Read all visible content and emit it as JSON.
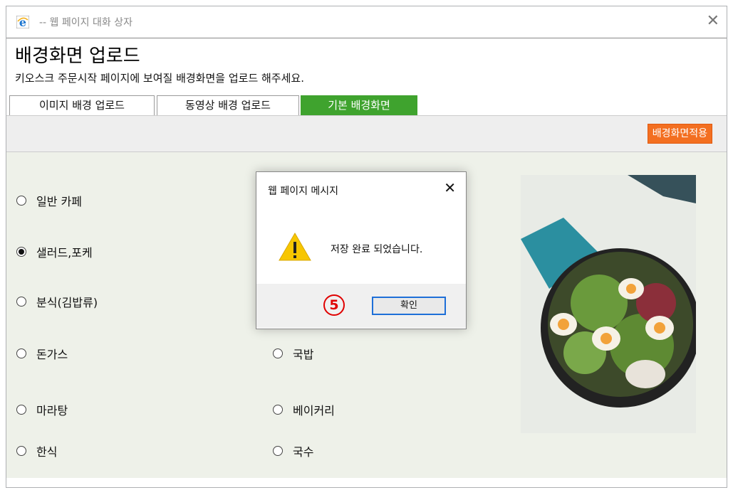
{
  "window": {
    "title": "-- 웹 페이지 대화 상자",
    "close_icon": "close-icon"
  },
  "page": {
    "title": "배경화면 업로드",
    "subtitle": "키오스크 주문시작 페이지에 보여질 배경화면을 업로드 해주세요."
  },
  "tabs": [
    {
      "label": "이미지 배경 업로드",
      "active": false
    },
    {
      "label": "동영상 배경 업로드",
      "active": false
    },
    {
      "label": "기본 배경화면",
      "active": true
    }
  ],
  "toolbar": {
    "apply_label": "배경화면적용"
  },
  "options": [
    {
      "label": "일반 카페",
      "checked": false
    },
    {
      "label": "샐러드,포케",
      "checked": true
    },
    {
      "label": "분식(김밥류)",
      "checked": false
    },
    {
      "label": "돈가스",
      "checked": false
    },
    {
      "label": "마라탕",
      "checked": false
    },
    {
      "label": "한식",
      "checked": false
    },
    {
      "label": "국밥",
      "checked": false
    },
    {
      "label": "베이커리",
      "checked": false
    },
    {
      "label": "국수",
      "checked": false
    }
  ],
  "dialog": {
    "title": "웹 페이지 메시지",
    "message": "저장 완료 되었습니다.",
    "ok_label": "확인",
    "step_badge": "5"
  },
  "colors": {
    "tab_active": "#3fa32e",
    "apply_button": "#f36f21",
    "content_bg": "#eef1e9",
    "badge": "#e00000"
  }
}
